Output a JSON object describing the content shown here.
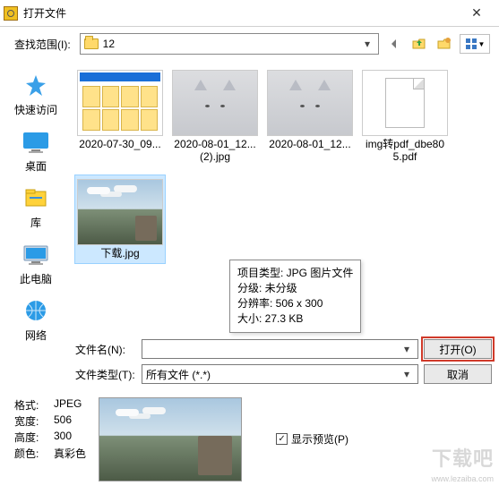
{
  "window": {
    "title": "打开文件"
  },
  "look_in": {
    "label": "查找范围(I):",
    "value": "12"
  },
  "places": {
    "quick": "快速访问",
    "desktop": "桌面",
    "libraries": "库",
    "this_pc": "此电脑",
    "network": "网络"
  },
  "files": [
    {
      "name": "2020-07-30_09..."
    },
    {
      "name": "2020-08-01_12... (2).jpg"
    },
    {
      "name": "2020-08-01_12..."
    },
    {
      "name": "img转pdf_dbe805.pdf"
    },
    {
      "name": "下载.jpg"
    }
  ],
  "tooltip": {
    "line1": "项目类型: JPG 图片文件",
    "line2": "分级: 未分级",
    "line3": "分辨率: 506 x 300",
    "line4": "大小: 27.3 KB"
  },
  "filename": {
    "label": "文件名(N):",
    "value": ""
  },
  "filetype": {
    "label": "文件类型(T):",
    "value": "所有文件 (*.*)"
  },
  "buttons": {
    "open": "打开(O)",
    "cancel": "取消"
  },
  "info": {
    "format_k": "格式:",
    "format_v": "JPEG",
    "width_k": "宽度:",
    "width_v": "506",
    "height_k": "高度:",
    "height_v": "300",
    "color_k": "颜色:",
    "color_v": "真彩色"
  },
  "preview": {
    "show_label": "显示预览(P)",
    "checked": "✓"
  },
  "watermark": {
    "main": "下载吧",
    "sub": "www.lezaiba.com"
  }
}
